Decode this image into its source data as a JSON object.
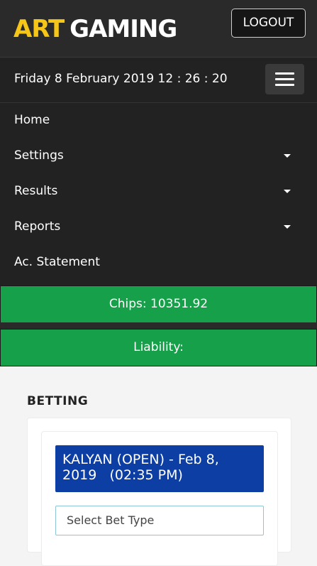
{
  "header": {
    "logo_part1": "ART",
    "logo_part2": "GAMING",
    "logout_label": "LOGOUT"
  },
  "nav": {
    "datetime": "Friday 8 February 2019 12 : 26 : 20",
    "menu_icon": "hamburger-icon",
    "items": [
      {
        "label": "Home",
        "has_dropdown": false
      },
      {
        "label": "Settings",
        "has_dropdown": true
      },
      {
        "label": "Results",
        "has_dropdown": true
      },
      {
        "label": "Reports",
        "has_dropdown": true
      },
      {
        "label": "Ac. Statement",
        "has_dropdown": false
      }
    ]
  },
  "account": {
    "chips_text": "Chips: 10351.92",
    "liability_text": "Liability:"
  },
  "betting": {
    "section_title": "BETTING",
    "market_title": "KALYAN (OPEN) - Feb 8,\n2019   (02:35 PM)",
    "bet_type_placeholder": "Select Bet Type"
  },
  "colors": {
    "logo_accent": "#f5c518",
    "info_bar_green": "#17a04a",
    "market_title_blue": "#0c3ea3",
    "navbar_dark": "#222222"
  }
}
